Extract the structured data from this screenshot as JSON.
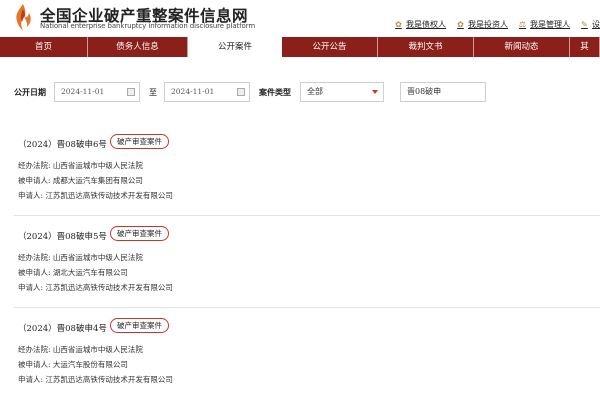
{
  "brand": {
    "title": "全国企业破产重整案件信息网",
    "subtitle": "National enterprise bankruptcy information disclosure platform"
  },
  "user_links": [
    {
      "label": "我是债权人",
      "icon": "creditor-icon"
    },
    {
      "label": "我是投资人",
      "icon": "investor-icon"
    },
    {
      "label": "我是管理人",
      "icon": "manager-icon"
    },
    {
      "label": "设",
      "icon": "settings-icon"
    }
  ],
  "nav": {
    "items": [
      {
        "label": "首页"
      },
      {
        "label": "债务人信息"
      },
      {
        "label": "公开案件"
      },
      {
        "label": "公开公告"
      },
      {
        "label": "裁判文书"
      },
      {
        "label": "新闻动态"
      },
      {
        "label": "其"
      }
    ],
    "active_index": 2
  },
  "search": {
    "date_label": "公开日期",
    "date_from": "2024-11-01",
    "to_label": "至",
    "date_to": "2024-11-01",
    "type_label": "案件类型",
    "type_value": "全部",
    "keyword_value": "晋08破申"
  },
  "cases": [
    {
      "title": "（2024）晋08破申6号",
      "badge": "破产审查案件",
      "court": "经办法院: 山西省运城市中级人民法院",
      "respondent": "被申请人: 成都大运汽车集团有限公司",
      "applicant": "申请人: 江苏凯迅达高铁传动技术开发有限公司"
    },
    {
      "title": "（2024）晋08破申5号",
      "badge": "破产审查案件",
      "court": "经办法院: 山西省运城市中级人民法院",
      "respondent": "被申请人: 湖北大运汽车有限公司",
      "applicant": "申请人: 江苏凯迅达高铁传动技术开发有限公司"
    },
    {
      "title": "（2024）晋08破申4号",
      "badge": "破产审查案件",
      "court": "经办法院: 山西省运城市中级人民法院",
      "respondent": "被申请人: 大运汽车股份有限公司",
      "applicant": "申请人: 江苏凯迅达高铁传动技术开发有限公司"
    }
  ],
  "colors": {
    "nav_bg": "#8b1f1a",
    "badge_border": "#c0392b",
    "logo_orange": "#e8742a"
  }
}
